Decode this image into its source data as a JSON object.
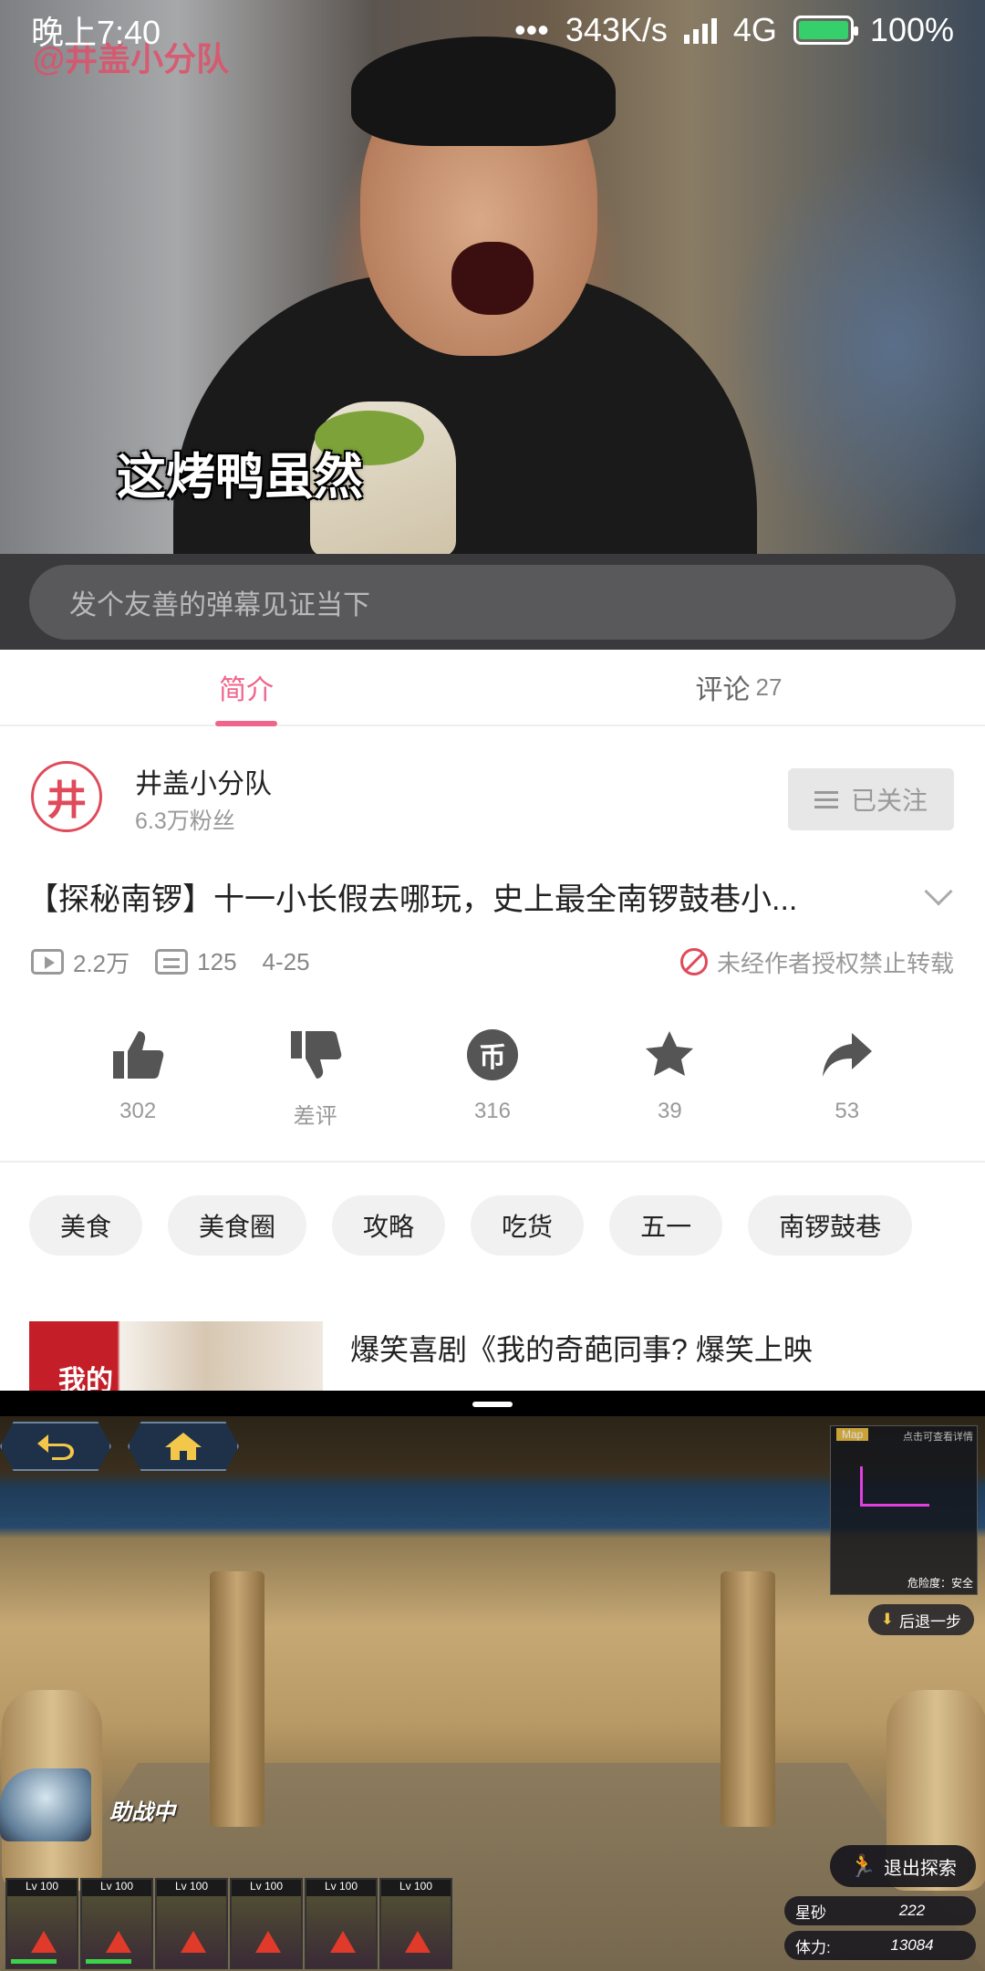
{
  "status_bar": {
    "time": "晚上7:40",
    "dots": "•••",
    "net_speed": "343K/s",
    "network": "4G",
    "battery": "100%"
  },
  "video": {
    "watermark": "@井盖小分队",
    "subtitle": "这烤鸭虽然",
    "danmaku_placeholder": "发个友善的弹幕见证当下"
  },
  "tabs": [
    {
      "label": "简介",
      "active": true
    },
    {
      "label": "评论",
      "count": "27",
      "active": false
    }
  ],
  "author": {
    "avatar_text": "井",
    "name": "井盖小分队",
    "fans": "6.3万粉丝",
    "follow_label": "已关注"
  },
  "video_info": {
    "title": "【探秘南锣】十一小长假去哪玩，史上最全南锣鼓巷小...",
    "views": "2.2万",
    "danmaku_count": "125",
    "date": "4-25",
    "copyright": "未经作者授权禁止转载"
  },
  "actions": [
    {
      "name": "like",
      "value": "302",
      "icon": "thumbs-up-icon"
    },
    {
      "name": "dislike",
      "value": "差评",
      "icon": "thumbs-down-icon"
    },
    {
      "name": "coin",
      "value": "316",
      "icon": "coin-icon",
      "glyph": "币"
    },
    {
      "name": "favorite",
      "value": "39",
      "icon": "star-icon"
    },
    {
      "name": "share",
      "value": "53",
      "icon": "share-icon"
    }
  ],
  "tags": [
    "美食",
    "美食圈",
    "攻略",
    "吃货",
    "五一",
    "南锣鼓巷"
  ],
  "recommendation": {
    "thumb_text": "我的",
    "title": "爆笑喜剧《我的奇葩同事? 爆笑上映"
  },
  "game": {
    "minimap_label": "Map",
    "minimap_hint": "点击可查看详情",
    "danger_text": "危险度：安全",
    "retreat_label": "后退一步",
    "assist_label": "助战中",
    "exit_label": "退出探索",
    "party": [
      {
        "lv": "Lv 100"
      },
      {
        "lv": "Lv 100"
      },
      {
        "lv": "Lv 100"
      },
      {
        "lv": "Lv 100"
      },
      {
        "lv": "Lv 100"
      },
      {
        "lv": "Lv 100"
      }
    ],
    "resources": [
      {
        "label": "星砂",
        "value": "222"
      },
      {
        "label": "体力:",
        "value": "13084"
      }
    ]
  },
  "colors": {
    "accent": "#f0648c",
    "author_red": "#e04a5a",
    "battery_green": "#35d06c"
  }
}
